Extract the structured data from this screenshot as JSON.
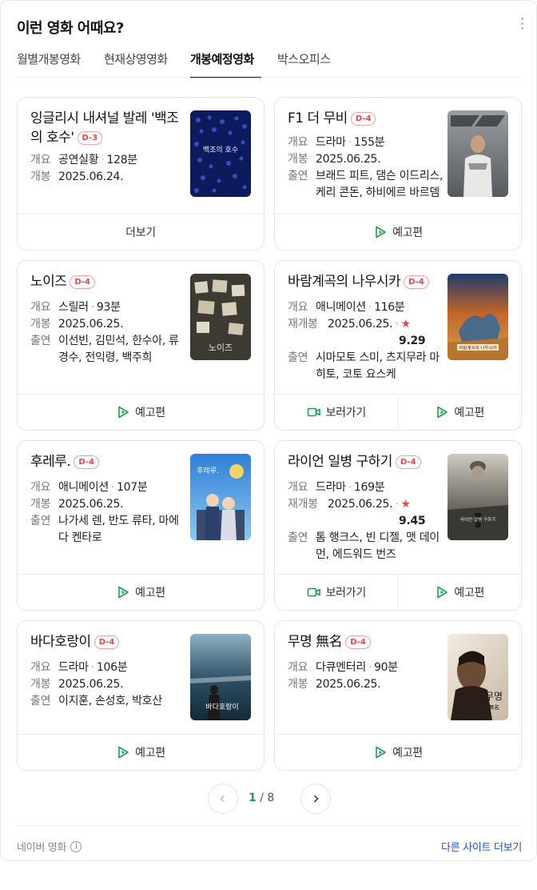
{
  "header": {
    "title": "이런 영화 어때요?",
    "more_icon": "more-vertical-icon"
  },
  "tabs": [
    "월별개봉영화",
    "현재상영영화",
    "개봉예정영화",
    "박스오피스"
  ],
  "active_tab": "개봉예정영화",
  "labels": {
    "overview": "개요",
    "release": "개봉",
    "rerelease": "재개봉",
    "cast": "출연",
    "more": "더보기",
    "trailer": "예고편",
    "watch": "보러가기",
    "star": "★"
  },
  "movies": [
    {
      "title": "잉글리시 내셔널 발레 '백조의 호수'",
      "dday": "D-3",
      "genre": "공연실황",
      "runtime": "128분",
      "date": "2025.06.24."
    },
    {
      "title": "F1 더 무비",
      "dday": "D-4",
      "genre": "드라마",
      "runtime": "155분",
      "date": "2025.06.25.",
      "cast": "브래드 피트, 댐슨 이드리스, 케리 콘돈, 하비에르 바르뎀"
    },
    {
      "title": "노이즈",
      "dday": "D-4",
      "genre": "스릴러",
      "runtime": "93분",
      "date": "2025.06.25.",
      "cast": "이선빈, 김민석, 한수아, 류경수, 전익령, 백주희"
    },
    {
      "title": "바람계곡의 나우시카",
      "dday": "D-4",
      "genre": "애니메이션",
      "runtime": "116분",
      "date": "2025.06.25.",
      "score": "9.29",
      "cast": "시마모토 스미, 츠지무라 마히토, 코토 요스케"
    },
    {
      "title": "후레루.",
      "dday": "D-4",
      "genre": "애니메이션",
      "runtime": "107분",
      "date": "2025.06.25.",
      "cast": "나가세 렌, 반도 류타, 마에다 켄타로"
    },
    {
      "title": "라이언 일병 구하기",
      "dday": "D-4",
      "genre": "드라마",
      "runtime": "169분",
      "date": "2025.06.25.",
      "score": "9.45",
      "cast": "톰 행크스, 빈 디젤, 맷 데이먼, 에드워드 번즈"
    },
    {
      "title": "바다호랑이",
      "dday": "D-4",
      "genre": "드라마",
      "runtime": "106분",
      "date": "2025.06.25.",
      "cast": "이지훈, 손성호, 박호산"
    },
    {
      "title": "무명 無名",
      "dday": "D-4",
      "genre": "다큐멘터리",
      "runtime": "90분",
      "date": "2025.06.25."
    }
  ],
  "poster_text": {
    "swan": "백조의 호수",
    "noise": "노이즈",
    "nausicaa": "바람계곡의 나우시카",
    "fureru": "후레루.",
    "ryan": "라이언 일병 구하기",
    "sea": "바다호랑이",
    "mumyeong": "무명",
    "mumyeong_sub": "無名"
  },
  "colors": {
    "accent": "#17a34a",
    "dday": "#e5484d",
    "link": "#1a56c8"
  },
  "pagination": {
    "current": "1",
    "sep": "/",
    "total": "8"
  },
  "footer": {
    "source": "네이버 영화",
    "info_icon": "i",
    "other_sites": "다른 사이트 더보기"
  }
}
